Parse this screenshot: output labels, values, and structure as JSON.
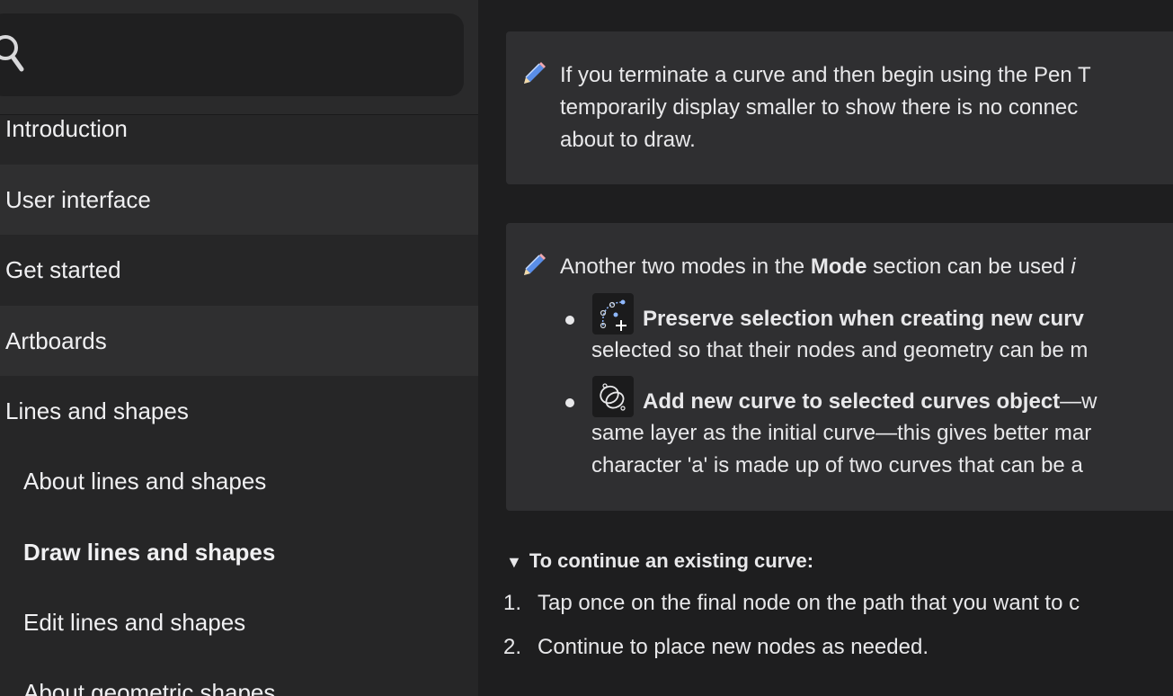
{
  "sidebar": {
    "search": {
      "placeholder": ""
    },
    "items": [
      {
        "label": "Introduction",
        "level": 1
      },
      {
        "label": "User interface",
        "level": 1
      },
      {
        "label": "Get started",
        "level": 1
      },
      {
        "label": "Artboards",
        "level": 1
      },
      {
        "label": "Lines and shapes",
        "level": 1
      },
      {
        "label": "About lines and shapes",
        "level": 2
      },
      {
        "label": "Draw lines and shapes",
        "level": 2,
        "current": true
      },
      {
        "label": "Edit lines and shapes",
        "level": 2
      },
      {
        "label": "About geometric shapes",
        "level": 2
      }
    ]
  },
  "main": {
    "note1": {
      "line1": "If you terminate a curve and then begin using the Pen T",
      "line2": "temporarily display smaller to show there is no connec",
      "line3": "about to draw."
    },
    "note2": {
      "intro_a": "Another two modes in the ",
      "intro_b": "Mode",
      "intro_c": " section can be used ",
      "intro_d": "i",
      "bullet1_title": "Preserve selection when creating new curv",
      "bullet1_line2": "selected so that their nodes and geometry can be m",
      "bullet2_title": "Add new curve to selected curves object",
      "bullet2_tail": "—w",
      "bullet2_line2": "same layer as the initial curve—this gives better mar",
      "bullet2_line3": "character 'a' is made up of two curves that can be a"
    },
    "section": {
      "arrow": "▼",
      "title": "To continue an existing curve:"
    },
    "steps": [
      {
        "num": "1.",
        "text": "Tap once on the final node on the path that you want to c"
      },
      {
        "num": "2.",
        "text": "Continue to place new nodes as needed."
      }
    ]
  }
}
